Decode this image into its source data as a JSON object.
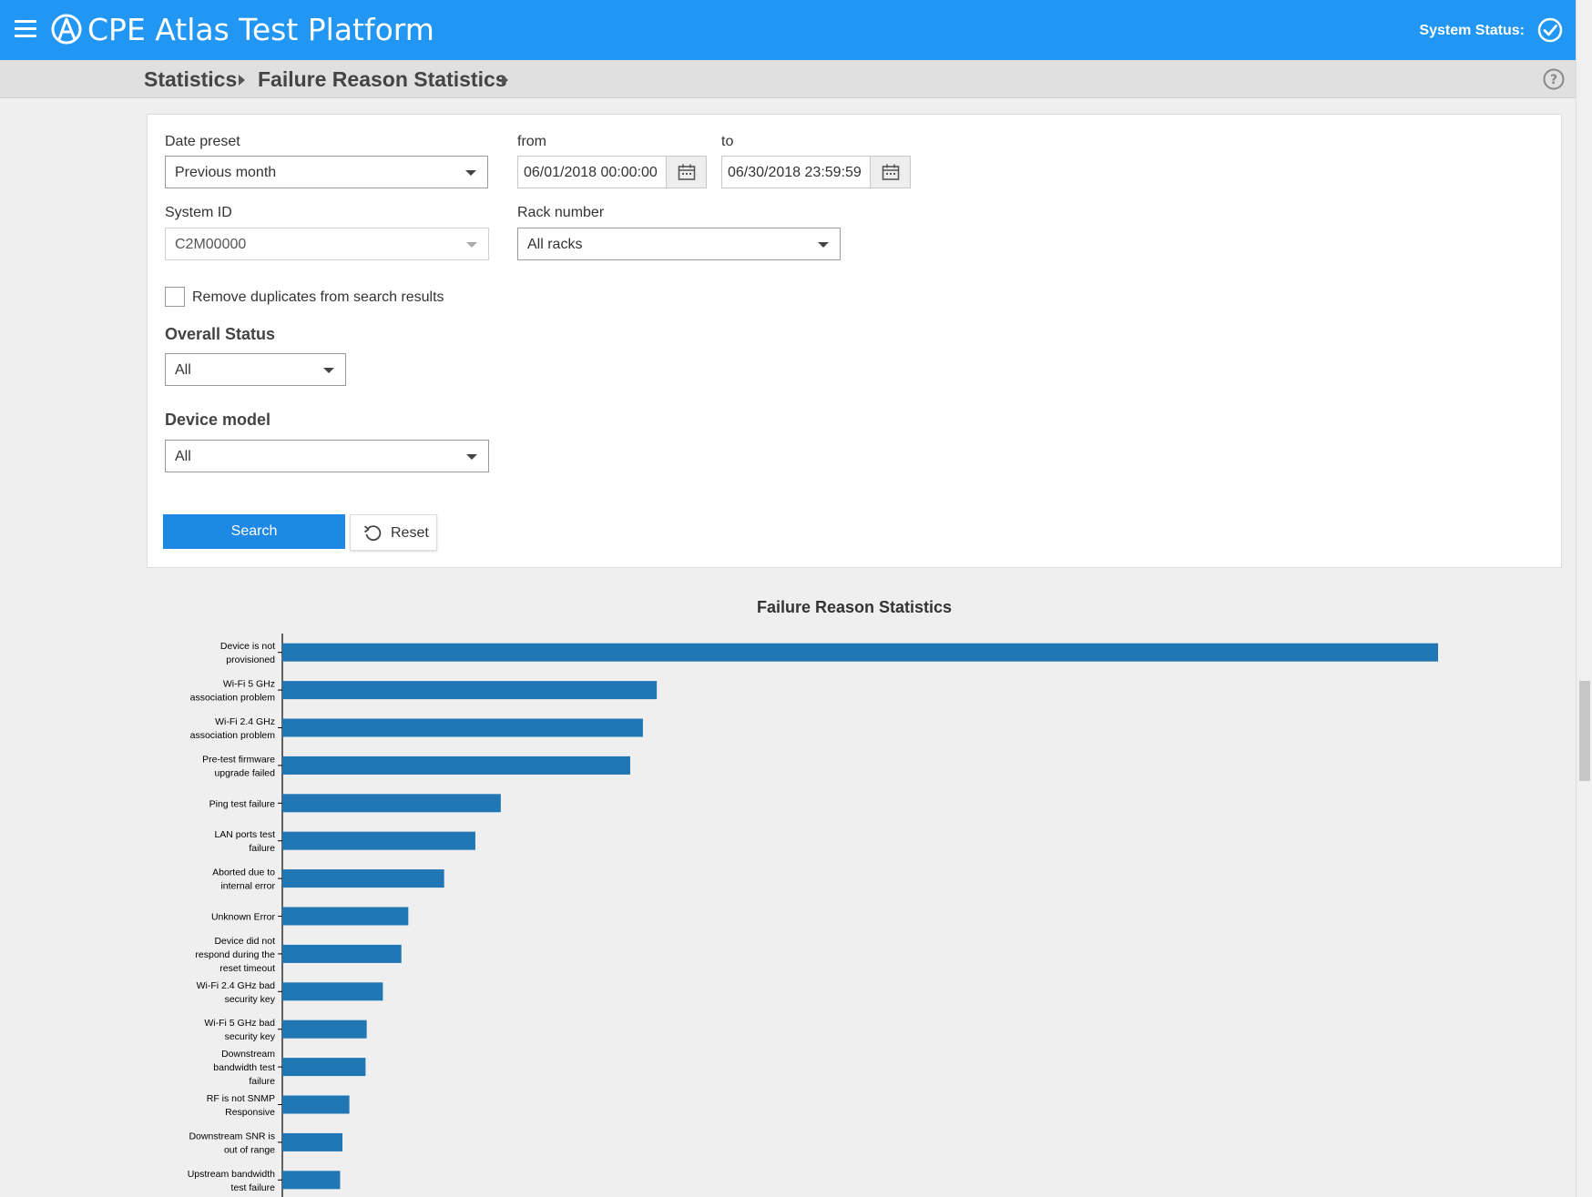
{
  "app": {
    "title": "CPE Atlas Test Platform",
    "system_status_label": "System Status:"
  },
  "breadcrumb": [
    "Statistics",
    "Failure Reason Statistics"
  ],
  "filters": {
    "date_preset": {
      "label": "Date preset",
      "value": "Previous month"
    },
    "from": {
      "label": "from",
      "value": "06/01/2018 00:00:00"
    },
    "to": {
      "label": "to",
      "value": "06/30/2018 23:59:59"
    },
    "system_id": {
      "label": "System ID",
      "value": "C2M00000"
    },
    "rack_number": {
      "label": "Rack number",
      "value": "All racks"
    },
    "remove_duplicates": {
      "label": "Remove duplicates from search results",
      "checked": false
    },
    "overall_status": {
      "label": "Overall Status",
      "value": "All"
    },
    "device_model": {
      "label": "Device model",
      "value": "All"
    }
  },
  "buttons": {
    "search": "Search",
    "reset": "Reset"
  },
  "colors": {
    "header": "#2196f3",
    "bar": "#2077b4",
    "primary_button": "#1e88e5"
  },
  "chart_data": {
    "type": "bar",
    "orientation": "horizontal",
    "title": "Failure Reason Statistics",
    "categories": [
      [
        "Device is not",
        "provisioned"
      ],
      [
        "Wi-Fi 5 GHz",
        "association problem"
      ],
      [
        "Wi-Fi 2.4 GHz",
        "association problem"
      ],
      [
        "Pre-test firmware",
        "upgrade failed"
      ],
      [
        "Ping test failure"
      ],
      [
        "LAN ports test",
        "failure"
      ],
      [
        "Aborted due to",
        "internal error"
      ],
      [
        "Unknown Error"
      ],
      [
        "Device did not",
        "respond during the",
        "reset timeout"
      ],
      [
        "Wi-Fi 2.4 GHz bad",
        "security key"
      ],
      [
        "Wi-Fi 5 GHz bad",
        "security key"
      ],
      [
        "Downstream",
        "bandwidth test",
        "failure"
      ],
      [
        "RF is not SNMP",
        "Responsive"
      ],
      [
        "Downstream SNR is",
        "out of range"
      ],
      [
        "Upstream bandwidth",
        "test failure"
      ]
    ],
    "values": [
      1000,
      324,
      312,
      301,
      189,
      167,
      140,
      109,
      103,
      87,
      73,
      72,
      58,
      52,
      50
    ],
    "xlim": [
      0,
      1000
    ],
    "grid": false,
    "legend": "none"
  }
}
